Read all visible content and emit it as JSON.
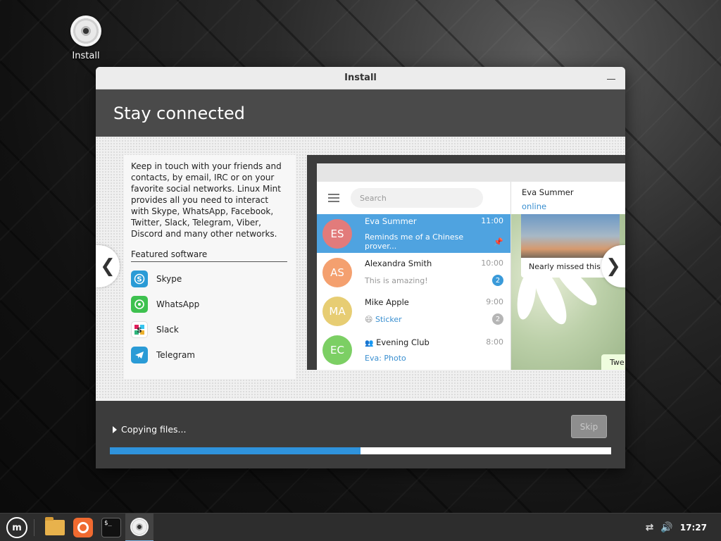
{
  "desktop": {
    "icon_label": "Install"
  },
  "window": {
    "title": "Install",
    "header": "Stay connected"
  },
  "slide": {
    "description": "Keep in touch with your friends and contacts, by email, IRC or on your favorite social networks. Linux Mint provides all you need to interact with Skype, WhatsApp, Facebook, Twitter, Slack, Telegram, Viber, Discord and many other networks.",
    "featured_title": "Featured software",
    "featured": [
      {
        "name": "Skype",
        "icon": "skype-icon",
        "color": "#2a9bd6"
      },
      {
        "name": "WhatsApp",
        "icon": "whatsapp-icon",
        "color": "#3ec14f"
      },
      {
        "name": "Slack",
        "icon": "slack-icon",
        "color": "#ffffff"
      },
      {
        "name": "Telegram",
        "icon": "telegram-icon",
        "color": "#2a9bd6"
      }
    ],
    "prev_glyph": "❮",
    "next_glyph": "❯"
  },
  "mockup": {
    "search_placeholder": "Search",
    "chats": [
      {
        "initials": "ES",
        "avatar_color": "#e27b7b",
        "name": "Eva Summer",
        "time": "11:00",
        "message": "Reminds me of a Chinese prover...",
        "badge": "",
        "active": true
      },
      {
        "initials": "AS",
        "avatar_color": "#f4a06f",
        "name": "Alexandra Smith",
        "time": "10:00",
        "message": "This is amazing!",
        "badge": "2",
        "badge_color": "#3a9ad9"
      },
      {
        "initials": "MA",
        "avatar_color": "#e7cd73",
        "name": "Mike Apple",
        "time": "9:00",
        "message": "Sticker",
        "message_prefix": "😄",
        "badge": "2",
        "badge_color": "#b5b5b5"
      },
      {
        "initials": "EC",
        "avatar_color": "#7ccf64",
        "name": "Evening Club",
        "time": "8:00",
        "message": "Eva: Photo",
        "badge": ""
      }
    ],
    "conversation": {
      "name": "Eva Summer",
      "status": "online",
      "photo_caption": "Nearly missed this s",
      "bubble_text": "Twe"
    }
  },
  "installer": {
    "status": "Copying files...",
    "skip_label": "Skip",
    "progress": 0.5
  },
  "taskbar": {
    "menu_label": "m",
    "terminal_text": "$_",
    "clock": "17:27"
  }
}
